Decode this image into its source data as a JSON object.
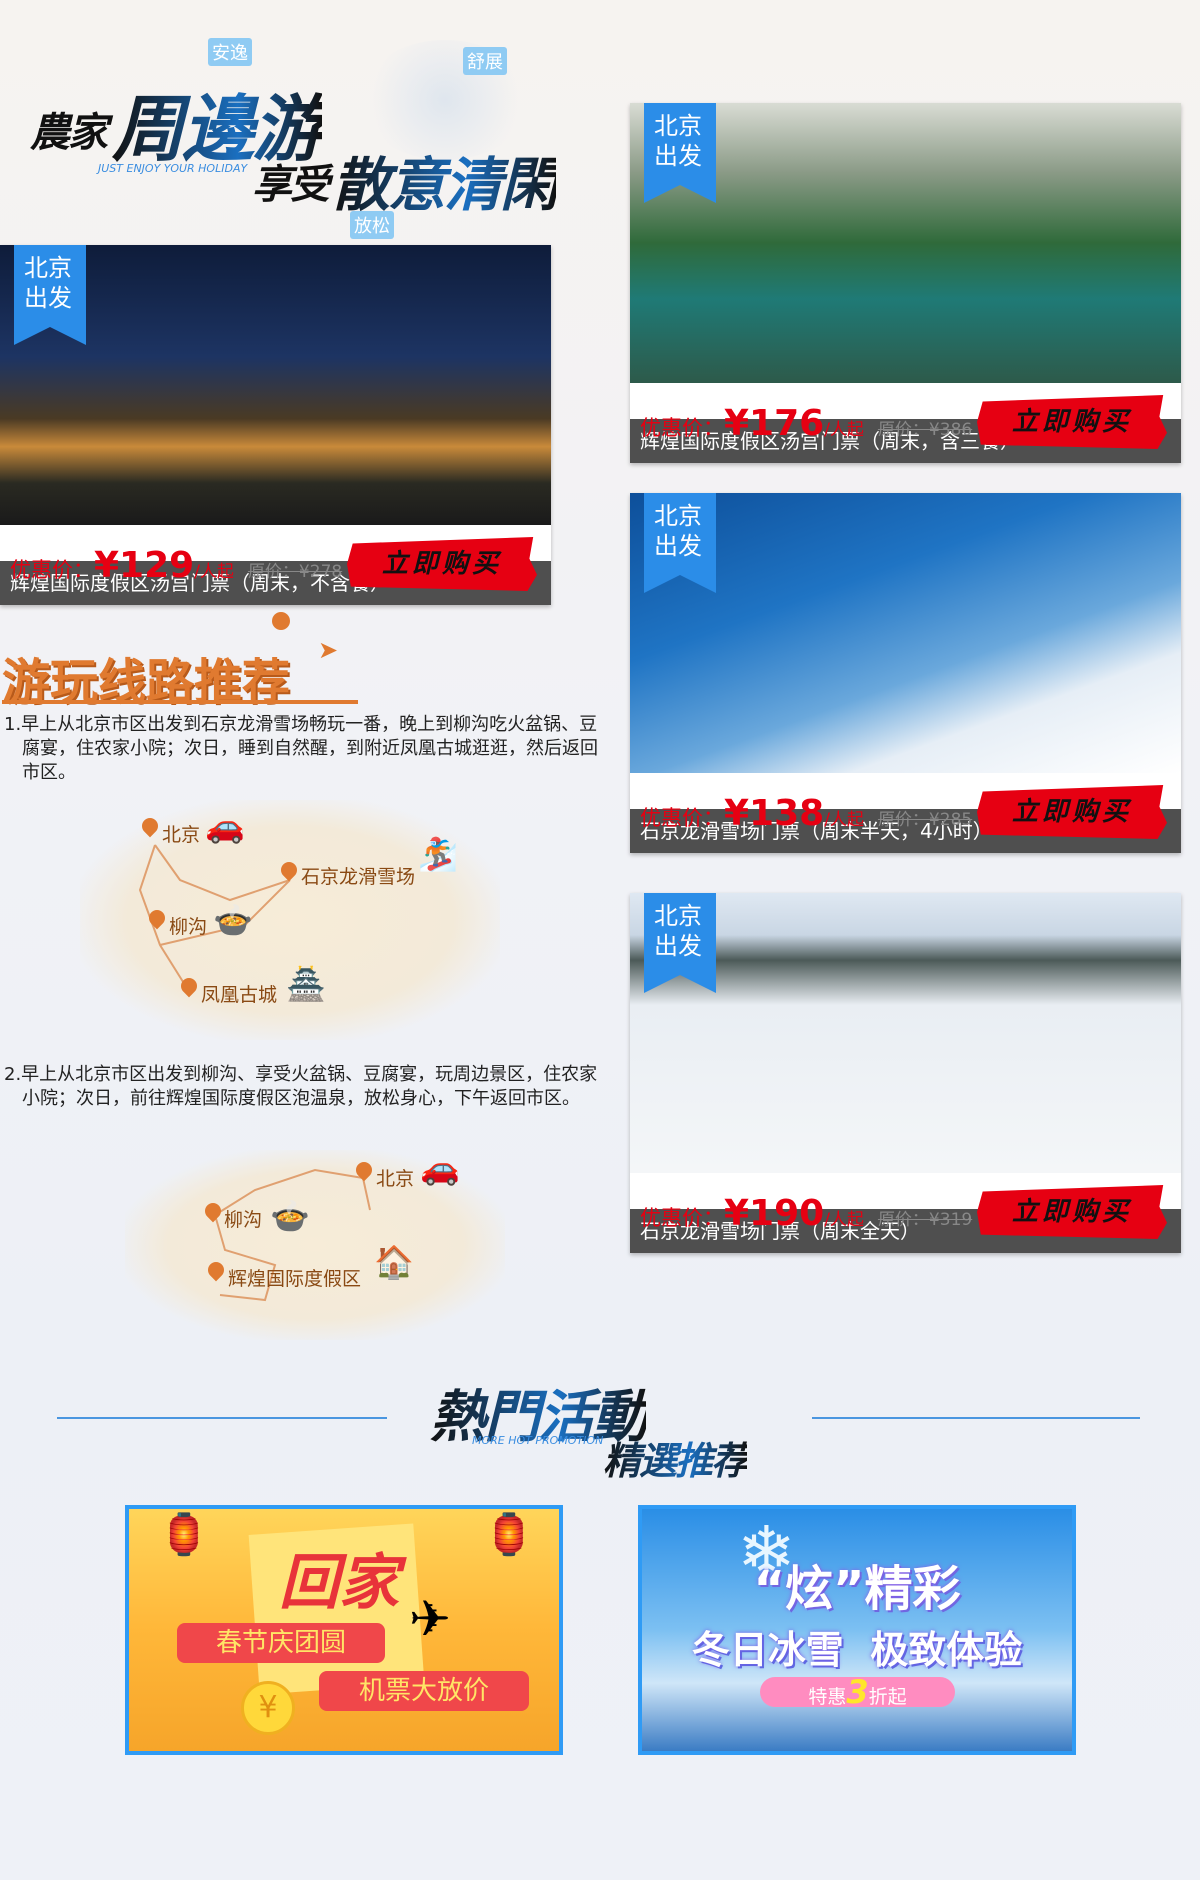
{
  "hero": {
    "tags": [
      "安逸",
      "舒展",
      "放松"
    ],
    "title_prefix": "農家",
    "title_main": "周邊游",
    "subtitle_prefix": "享受",
    "subtitle_main": "散意清閑",
    "english": "JUST ENJOY YOUR HOLIDAY"
  },
  "products": [
    {
      "ribbon": "北京出发",
      "ribbon_l1": "北京",
      "ribbon_l2": "出发",
      "caption": "辉煌国际度假区汤宫门票（周末，不含餐）",
      "price_label": "优惠价：",
      "price": "¥129",
      "unit": "/人起",
      "original": "原价：¥278",
      "buy": "立即购买",
      "photo": "resort-night"
    },
    {
      "ribbon_l1": "北京",
      "ribbon_l2": "出发",
      "caption": "辉煌国际度假区汤宫门票（周末，含三餐）",
      "price_label": "优惠价：",
      "price": "¥176",
      "unit": "/人起",
      "original": "原价：¥386",
      "buy": "立即购买",
      "photo": "indoor-pool"
    },
    {
      "ribbon_l1": "北京",
      "ribbon_l2": "出发",
      "caption": "石京龙滑雪场门票（周末半天，4小时）",
      "price_label": "优惠价：",
      "price": "¥138",
      "unit": "/人起",
      "original": "原价：¥285",
      "buy": "立即购买",
      "photo": "ski-jump"
    },
    {
      "ribbon_l1": "北京",
      "ribbon_l2": "出发",
      "caption": "石京龙滑雪场门票（周末全天）",
      "price_label": "优惠价：",
      "price": "¥190",
      "unit": "/人起",
      "original": "原价：¥319",
      "buy": "立即购买",
      "photo": "ski-slope"
    }
  ],
  "routes": {
    "title": "游玩线路推荐",
    "items": [
      {
        "text": "1.早上从北京市区出发到石京龙滑雪场畅玩一番，晚上到柳沟吃火盆锅、豆腐宴，住农家小院；次日，睡到自然醒，到附近凤凰古城逛逛，然后返回市区。",
        "map": [
          "北京",
          "石京龙滑雪场",
          "柳沟",
          "凤凰古城"
        ]
      },
      {
        "text": "2.早上从北京市区出发到柳沟、享受火盆锅、豆腐宴，玩周边景区，住农家小院；次日，前往辉煌国际度假区泡温泉，放松身心，下午返回市区。",
        "map": [
          "北京",
          "柳沟",
          "辉煌国际度假区"
        ]
      }
    ]
  },
  "hot": {
    "title": "熱門活動",
    "subtitle": "精選推荐",
    "english": "MORE HOT PROMOTION"
  },
  "banners": [
    {
      "headline": "回家",
      "line1": "春节庆团圆",
      "line2": "机票大放价"
    },
    {
      "headline": "“炫”精彩",
      "line1": "冬日冰雪  极致体验",
      "badge_pre": "特惠",
      "badge_num": "3",
      "badge_post": "折起"
    }
  ],
  "colors": {
    "accent_blue": "#2b8de8",
    "price_red": "#e60012",
    "route_orange": "#e07a30"
  }
}
